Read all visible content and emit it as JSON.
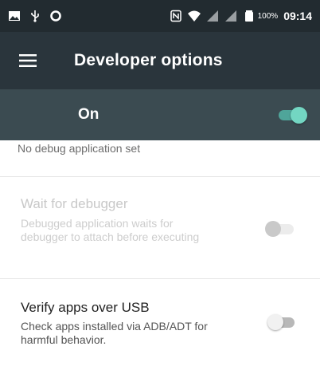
{
  "status_bar": {
    "left_icons": [
      "image-icon",
      "usb-icon",
      "sync-icon"
    ],
    "right_icons": [
      "nfc-icon",
      "wifi-icon",
      "signal-icon",
      "signal-icon",
      "battery-icon"
    ],
    "battery_percent": "100%",
    "time": "09:14"
  },
  "app_bar": {
    "title": "Developer options",
    "menu_icon": "menu-icon"
  },
  "master_switch": {
    "label": "On",
    "checked": true
  },
  "preferences": {
    "debug_app_summary": "No debug application set",
    "wait_for_debugger": {
      "title": "Wait for debugger",
      "summary": "Debugged application waits for debugger to attach before executing",
      "checked": false,
      "enabled": false
    },
    "verify_apps_usb": {
      "title": "Verify apps over USB",
      "summary": "Check apps installed via ADB/ADT for harmful behavior.",
      "checked": false,
      "enabled": true
    }
  },
  "colors": {
    "status_bar": "#222b30",
    "app_bar": "#2a353c",
    "master_bar": "#3b4b51",
    "accent": "#73d6c2"
  }
}
